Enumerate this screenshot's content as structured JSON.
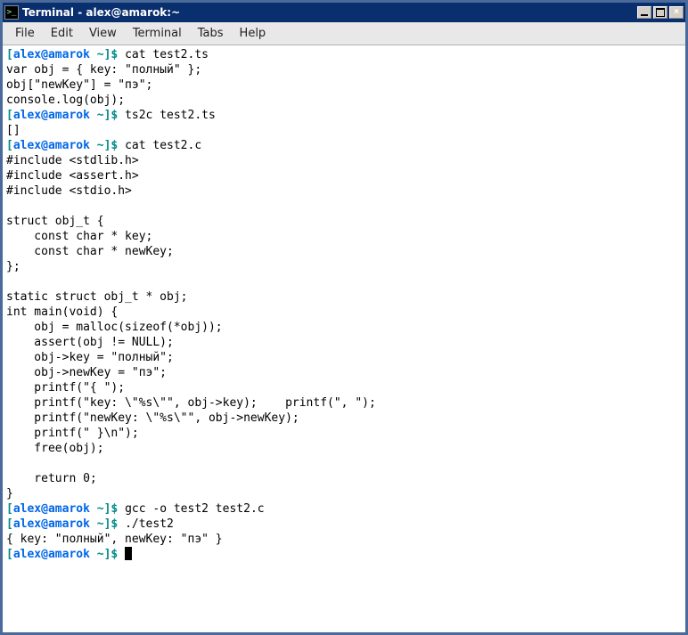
{
  "window": {
    "title": "Terminal - alex@amarok:~"
  },
  "menubar": {
    "items": [
      {
        "label": "File"
      },
      {
        "label": "Edit"
      },
      {
        "label": "View"
      },
      {
        "label": "Terminal"
      },
      {
        "label": "Tabs"
      },
      {
        "label": "Help"
      }
    ]
  },
  "prompt": {
    "lbr": "[",
    "user": "alex@amarok",
    "path": " ~",
    "rbr": "]",
    "dollar": "$ "
  },
  "session": {
    "cmd1": "cat test2.ts",
    "out1a": "var obj = { key: \"полный\" };",
    "out1b": "obj[\"newKey\"] = \"пэ\";",
    "out1c": "console.log(obj);",
    "cmd2": "ts2c test2.ts",
    "out2": "[]",
    "cmd3": "cat test2.c",
    "out3a": "#include <stdlib.h>",
    "out3b": "#include <assert.h>",
    "out3c": "#include <stdio.h>",
    "out3d": "",
    "out3e": "struct obj_t {",
    "out3f": "    const char * key;",
    "out3g": "    const char * newKey;",
    "out3h": "};",
    "out3i": "",
    "out3j": "static struct obj_t * obj;",
    "out3k": "int main(void) {",
    "out3l": "    obj = malloc(sizeof(*obj));",
    "out3m": "    assert(obj != NULL);",
    "out3n": "    obj->key = \"полный\";",
    "out3o": "    obj->newKey = \"пэ\";",
    "out3p": "    printf(\"{ \");",
    "out3q": "    printf(\"key: \\\"%s\\\"\", obj->key);    printf(\", \");",
    "out3r": "    printf(\"newKey: \\\"%s\\\"\", obj->newKey);",
    "out3s": "    printf(\" }\\n\");",
    "out3t": "    free(obj);",
    "out3u": "",
    "out3v": "    return 0;",
    "out3w": "}",
    "cmd4": "gcc -o test2 test2.c",
    "cmd5": "./test2",
    "out5": "{ key: \"полный\", newKey: \"пэ\" }"
  }
}
